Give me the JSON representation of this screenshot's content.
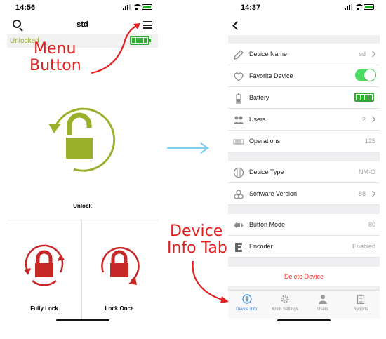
{
  "left_screen": {
    "status_time": "14:56",
    "title": "std",
    "status_text": "Unlocked",
    "unlock_label": "Unlock",
    "fully_lock_label": "Fully Lock",
    "lock_once_label": "Lock Once"
  },
  "annotations": {
    "menu_line1": "Menu",
    "menu_line2": "Button",
    "device_line1": "Device",
    "device_line2": "Info Tab"
  },
  "right_screen": {
    "status_time": "14:37",
    "rows": {
      "device_name": {
        "label": "Device Name",
        "value": "sd"
      },
      "favorite": {
        "label": "Favorite Device",
        "enabled": true
      },
      "battery": {
        "label": "Battery"
      },
      "users": {
        "label": "Users",
        "value": "2"
      },
      "operations": {
        "label": "Operations",
        "value": "125"
      },
      "device_type": {
        "label": "Device Type",
        "value": "NM-O"
      },
      "software_version": {
        "label": "Software Version",
        "value": "88"
      },
      "button_mode": {
        "label": "Button Mode",
        "value": "80"
      },
      "encoder": {
        "label": "Encoder",
        "value": "Enabled"
      }
    },
    "delete_label": "Delete Device",
    "tabs": [
      {
        "label": "Device Info.",
        "icon": "info-icon",
        "active": true
      },
      {
        "label": "Knob Settings",
        "icon": "gear-icon",
        "active": false
      },
      {
        "label": "Users",
        "icon": "user-icon",
        "active": false
      },
      {
        "label": "Reports",
        "icon": "clipboard-icon",
        "active": false
      }
    ]
  },
  "colors": {
    "accent_green": "#9ab02a",
    "lock_red": "#c62828",
    "annotation_red": "#e02020",
    "arrow_blue": "#7fcfef",
    "tab_blue": "#2a7fdc",
    "toggle_green": "#4cd964"
  }
}
